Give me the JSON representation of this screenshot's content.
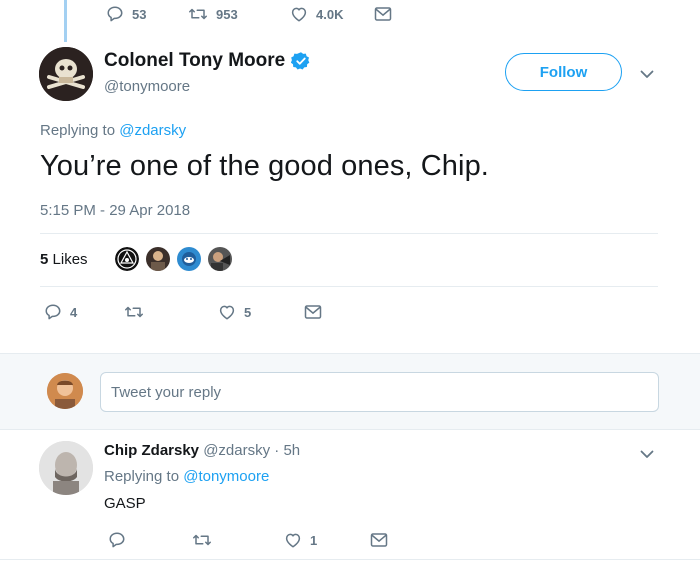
{
  "top_actions": {
    "reply_count": "53",
    "retweet_count": "953",
    "like_count": "4.0K"
  },
  "main_tweet": {
    "author_name": "Colonel Tony Moore",
    "author_handle": "@tonymoore",
    "follow_label": "Follow",
    "replying_prefix": "Replying to ",
    "replying_to": "@zdarsky",
    "text": "You’re one of the good ones, Chip.",
    "timestamp": "5:15 PM - 29 Apr 2018",
    "likes_count": "5",
    "likes_word": "Likes",
    "reply_count": "4",
    "retweet_count": "",
    "like_count": "5"
  },
  "reply_box": {
    "placeholder": "Tweet your reply"
  },
  "reply_tweet": {
    "author_name": "Chip Zdarsky",
    "author_handle": "@zdarsky",
    "time": "· 5h",
    "replying_prefix": "Replying to ",
    "replying_to": "@tonymoore",
    "text": "GASP",
    "reply_count": "",
    "retweet_count": "",
    "like_count": "1"
  },
  "colors": {
    "accent": "#1da1f2",
    "muted": "#657786",
    "text": "#14171a",
    "thread_line": "#a3d0f2",
    "verified": "#1da1f2"
  },
  "icons": [
    "reply-icon",
    "retweet-icon",
    "like-icon",
    "dm-icon",
    "verified-icon",
    "chevron-down-icon"
  ]
}
